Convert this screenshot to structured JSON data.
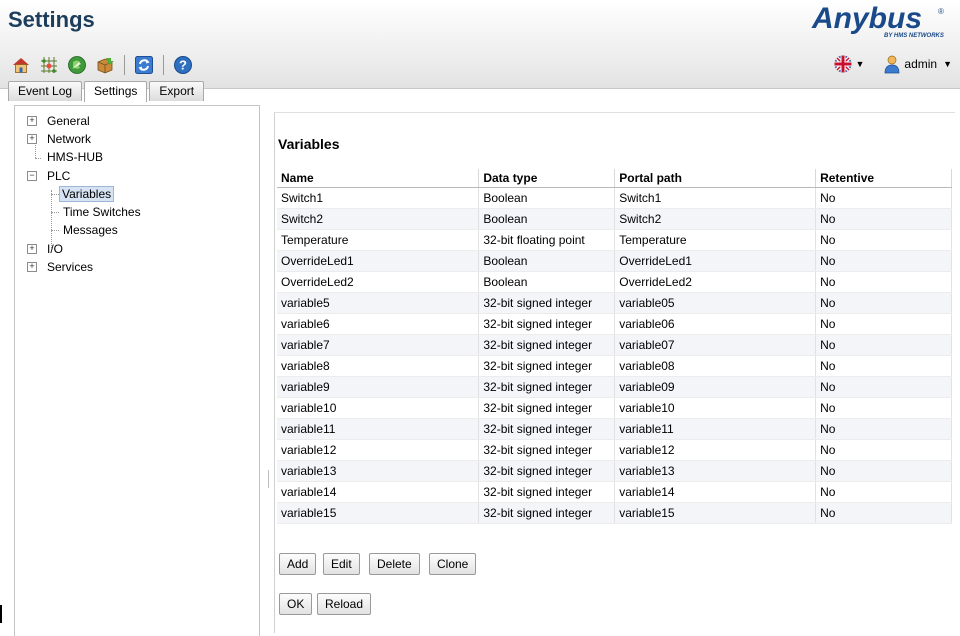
{
  "header": {
    "title": "Settings",
    "logo_text": "Anybus",
    "logo_sub": "BY HMS NETWORKS"
  },
  "toolbar": {
    "icons": [
      "home-icon",
      "network-grid-icon",
      "globe-icon",
      "package-icon",
      "refresh-icon",
      "help-icon"
    ]
  },
  "user": {
    "name": "admin",
    "language_icon": "uk-flag-icon"
  },
  "tabs": [
    {
      "label": "Event Log"
    },
    {
      "label": "Settings"
    },
    {
      "label": "Export"
    }
  ],
  "tree": {
    "general": "General",
    "network": "Network",
    "hms_hub": "HMS-HUB",
    "plc": "PLC",
    "variables": "Variables",
    "time_switches": "Time Switches",
    "messages": "Messages",
    "io": "I/O",
    "services": "Services"
  },
  "main": {
    "title": "Variables",
    "columns": [
      "Name",
      "Data type",
      "Portal path",
      "Retentive"
    ],
    "rows": [
      [
        "Switch1",
        "Boolean",
        "Switch1",
        "No"
      ],
      [
        "Switch2",
        "Boolean",
        "Switch2",
        "No"
      ],
      [
        "Temperature",
        "32-bit floating point",
        "Temperature",
        "No"
      ],
      [
        "OverrideLed1",
        "Boolean",
        "OverrideLed1",
        "No"
      ],
      [
        "OverrideLed2",
        "Boolean",
        "OverrideLed2",
        "No"
      ],
      [
        "variable5",
        "32-bit signed integer",
        "variable05",
        "No"
      ],
      [
        "variable6",
        "32-bit signed integer",
        "variable06",
        "No"
      ],
      [
        "variable7",
        "32-bit signed integer",
        "variable07",
        "No"
      ],
      [
        "variable8",
        "32-bit signed integer",
        "variable08",
        "No"
      ],
      [
        "variable9",
        "32-bit signed integer",
        "variable09",
        "No"
      ],
      [
        "variable10",
        "32-bit signed integer",
        "variable10",
        "No"
      ],
      [
        "variable11",
        "32-bit signed integer",
        "variable11",
        "No"
      ],
      [
        "variable12",
        "32-bit signed integer",
        "variable12",
        "No"
      ],
      [
        "variable13",
        "32-bit signed integer",
        "variable13",
        "No"
      ],
      [
        "variable14",
        "32-bit signed integer",
        "variable14",
        "No"
      ],
      [
        "variable15",
        "32-bit signed integer",
        "variable15",
        "No"
      ]
    ],
    "buttons": {
      "add": "Add",
      "edit": "Edit",
      "delete": "Delete",
      "clone": "Clone",
      "ok": "OK",
      "reload": "Reload"
    }
  },
  "colors": {
    "title": "#1d3d5c",
    "logo": "#1a4a8a",
    "selected_bg": "#d6e3f2",
    "row_alt": "#f3f5f8"
  }
}
